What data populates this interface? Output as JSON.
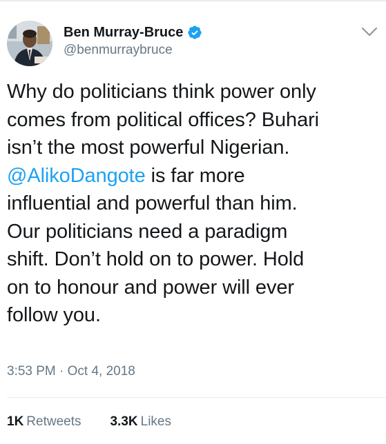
{
  "user": {
    "display_name": "Ben Murray-Bruce",
    "handle": "@benmurraybruce",
    "verified_icon": "verified-badge-icon"
  },
  "tweet": {
    "lines": [
      "Why do politicians think power only",
      "comes from political offices? Buhari",
      "isn’t the most powerful Nigerian.",
      " is far more",
      "influential and powerful than him.",
      "Our politicians need a paradigm",
      "shift. Don’t hold on to power. Hold",
      "on to honour and power will ever",
      "follow you."
    ],
    "mention": "@AlikoDangote",
    "timestamp": "3:53 PM · Oct 4, 2018"
  },
  "stats": {
    "retweets_count": "1K",
    "retweets_label": "Retweets",
    "likes_count": "3.3K",
    "likes_label": "Likes"
  },
  "colors": {
    "link": "#1da1f2",
    "secondary_text": "#657786",
    "primary_text": "#14171a",
    "divider": "#e6ecf0"
  }
}
